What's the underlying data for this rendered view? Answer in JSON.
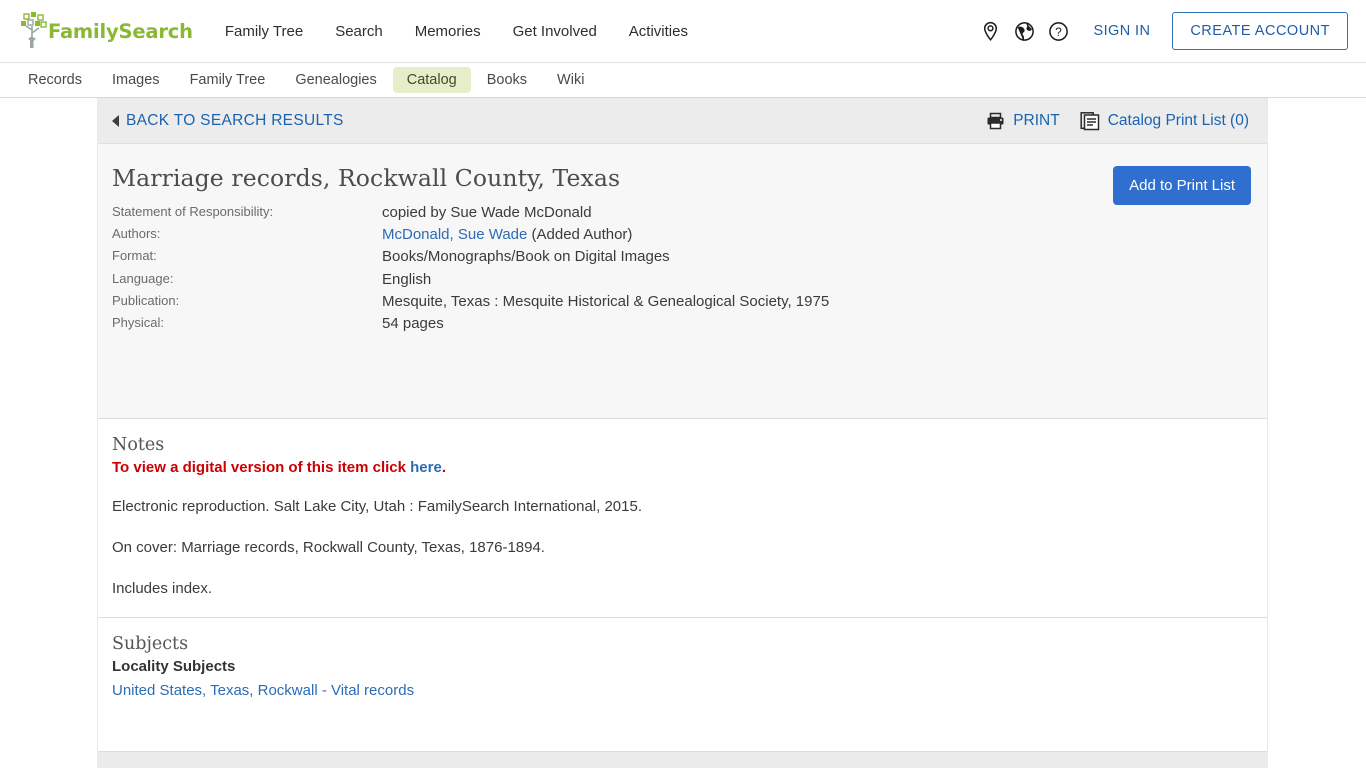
{
  "header": {
    "logo_text": "FamilySearch",
    "logo_icon": "family-tree-logo",
    "nav": [
      {
        "label": "Family Tree"
      },
      {
        "label": "Search"
      },
      {
        "label": "Memories"
      },
      {
        "label": "Get Involved"
      },
      {
        "label": "Activities"
      }
    ],
    "icons": [
      {
        "name": "location-pin-icon"
      },
      {
        "name": "globe-icon"
      },
      {
        "name": "help-circle-icon"
      }
    ],
    "sign_in": "SIGN IN",
    "create_account": "CREATE ACCOUNT"
  },
  "subnav": {
    "items": [
      {
        "label": "Records",
        "active": false
      },
      {
        "label": "Images",
        "active": false
      },
      {
        "label": "Family Tree",
        "active": false
      },
      {
        "label": "Genealogies",
        "active": false
      },
      {
        "label": "Catalog",
        "active": true
      },
      {
        "label": "Books",
        "active": false
      },
      {
        "label": "Wiki",
        "active": false
      }
    ]
  },
  "toolbar": {
    "back_label": "BACK TO SEARCH RESULTS",
    "print_label": "PRINT",
    "print_icon": "printer-icon",
    "catalog_print_list_label": "Catalog Print List (0)",
    "catalog_print_list_icon": "document-list-icon"
  },
  "record": {
    "title": "Marriage records, Rockwall County, Texas",
    "add_to_print_list": "Add to Print List",
    "fields": [
      {
        "label": "Statement of Responsibility:",
        "value": "copied by Sue Wade McDonald",
        "link": null,
        "suffix": null
      },
      {
        "label": "Authors:",
        "value": null,
        "link": "McDonald, Sue Wade",
        "suffix": " (Added Author)"
      },
      {
        "label": "Format:",
        "value": "Books/Monographs/Book on Digital Images",
        "link": null,
        "suffix": null
      },
      {
        "label": "Language:",
        "value": "English",
        "link": null,
        "suffix": null
      },
      {
        "label": "Publication:",
        "value": "Mesquite, Texas : Mesquite Historical & Genealogical Society, 1975",
        "link": null,
        "suffix": null
      },
      {
        "label": "Physical:",
        "value": "54 pages",
        "link": null,
        "suffix": null
      }
    ]
  },
  "notes": {
    "heading": "Notes",
    "digital_prefix": "To view a digital version of this item click ",
    "digital_link": "here",
    "digital_suffix": ".",
    "lines": [
      "Electronic reproduction. Salt Lake City, Utah : FamilySearch International, 2015.",
      "On cover: Marriage records, Rockwall County, Texas, 1876-1894.",
      "Includes index."
    ]
  },
  "subjects": {
    "heading": "Subjects",
    "locality_heading": "Locality Subjects",
    "items": [
      {
        "label": "United States, Texas, Rockwall - Vital records"
      }
    ]
  },
  "colors": {
    "brand_green": "#8ab833",
    "link_blue": "#2b6cb5",
    "alert_red": "#cc0000",
    "button_blue": "#2f6fd0",
    "active_tab_bg": "#e4eec9"
  }
}
